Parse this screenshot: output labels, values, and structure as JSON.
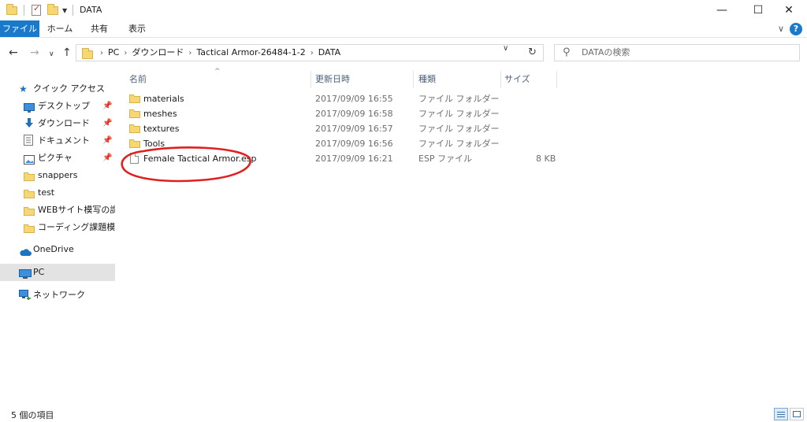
{
  "window": {
    "title": "DATA",
    "controls": {
      "minimize": "—",
      "maximize": "☐",
      "close": "✕"
    }
  },
  "ribbon": {
    "tabs": [
      "ファイル",
      "ホーム",
      "共有",
      "表示"
    ],
    "expand": "∨",
    "help": "?"
  },
  "navigation": {
    "back": "←",
    "forward": "→",
    "recent": "∨",
    "up": "↑",
    "breadcrumb": [
      "PC",
      "ダウンロード",
      "Tactical Armor-26484-1-2",
      "DATA"
    ],
    "refresh": "↻",
    "search_placeholder": "DATAの検索"
  },
  "sidebar": {
    "items": [
      {
        "label": "クイック アクセス",
        "icon": "star-icon",
        "pinned": false,
        "selected": false
      },
      {
        "label": "デスクトップ",
        "icon": "desktop-icon",
        "pinned": true,
        "selected": false
      },
      {
        "label": "ダウンロード",
        "icon": "download-icon",
        "pinned": true,
        "selected": false
      },
      {
        "label": "ドキュメント",
        "icon": "document-icon",
        "pinned": true,
        "selected": false
      },
      {
        "label": "ピクチャ",
        "icon": "pictures-icon",
        "pinned": true,
        "selected": false
      },
      {
        "label": "snappers",
        "icon": "folder-icon",
        "pinned": false,
        "selected": false
      },
      {
        "label": "test",
        "icon": "folder-icon",
        "pinned": false,
        "selected": false
      },
      {
        "label": "WEBサイト模写の課題",
        "icon": "folder-icon",
        "pinned": false,
        "selected": false
      },
      {
        "label": "コーディング課題模写",
        "icon": "folder-icon",
        "pinned": false,
        "selected": false
      },
      {
        "label": "OneDrive",
        "icon": "cloud-icon",
        "pinned": false,
        "selected": false
      },
      {
        "label": "PC",
        "icon": "computer-icon",
        "pinned": false,
        "selected": true
      },
      {
        "label": "ネットワーク",
        "icon": "network-icon",
        "pinned": false,
        "selected": false
      }
    ],
    "pin_glyph": "📌"
  },
  "file_list": {
    "columns": [
      "名前",
      "更新日時",
      "種類",
      "サイズ"
    ],
    "rows": [
      {
        "name": "materials",
        "modified": "2017/09/09 16:55",
        "type": "ファイル フォルダー",
        "size": "",
        "icon": "folder-icon"
      },
      {
        "name": "meshes",
        "modified": "2017/09/09 16:58",
        "type": "ファイル フォルダー",
        "size": "",
        "icon": "folder-icon"
      },
      {
        "name": "textures",
        "modified": "2017/09/09 16:57",
        "type": "ファイル フォルダー",
        "size": "",
        "icon": "folder-icon"
      },
      {
        "name": "Tools",
        "modified": "2017/09/09 16:56",
        "type": "ファイル フォルダー",
        "size": "",
        "icon": "folder-icon"
      },
      {
        "name": "Female Tactical Armor.esp",
        "modified": "2017/09/09 16:21",
        "type": "ESP ファイル",
        "size": "8 KB",
        "icon": "file-icon"
      }
    ]
  },
  "status_bar": {
    "item_count": "5 個の項目"
  },
  "colors": {
    "accent": "#1979ca",
    "folder": "#f7d774",
    "annotation": "#e02020",
    "selected_bg": "#e3e3e3"
  }
}
